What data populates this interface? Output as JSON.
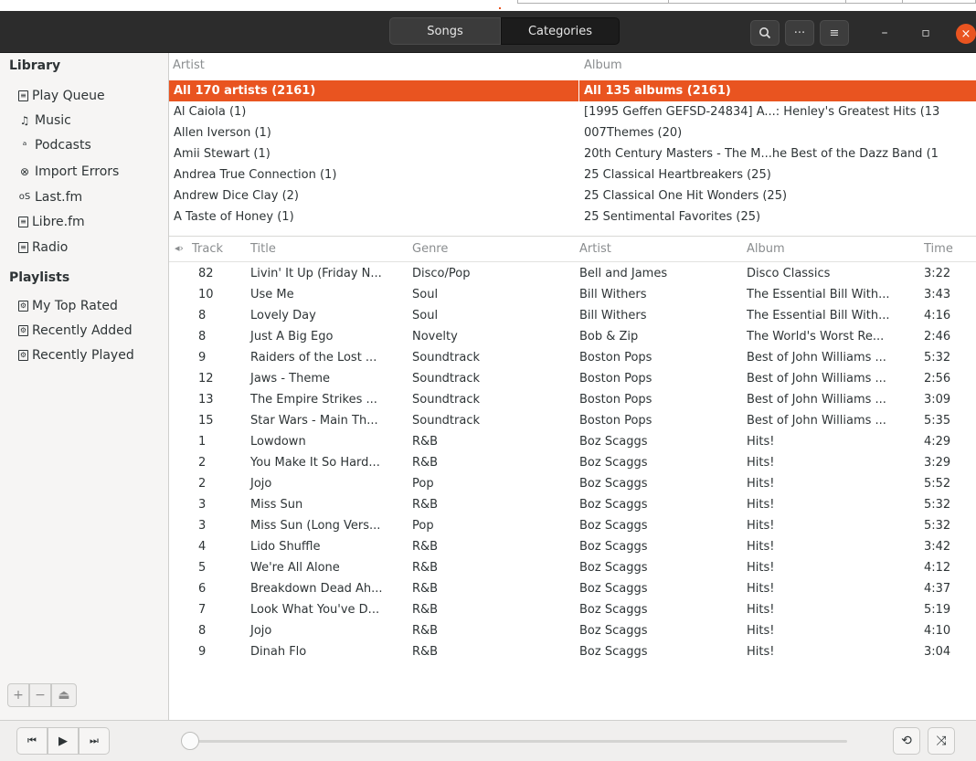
{
  "header": {
    "tabs": [
      {
        "label": "Songs",
        "active": false
      },
      {
        "label": "Categories",
        "active": true
      }
    ],
    "icons": [
      "search-icon",
      "more-icon",
      "menu-icon",
      "minimize-icon",
      "maximize-icon",
      "close-icon"
    ]
  },
  "sidebar": {
    "library_heading": "Library",
    "library_items": [
      {
        "label": "Play Queue",
        "icon": "play-queue-icon"
      },
      {
        "label": "Music",
        "icon": "music-note-icon"
      },
      {
        "label": "Podcasts",
        "icon": "rss-icon"
      },
      {
        "label": "Import Errors",
        "icon": "error-icon"
      },
      {
        "label": "Last.fm",
        "icon": "lastfm-icon"
      },
      {
        "label": "Libre.fm",
        "icon": "librefm-icon"
      },
      {
        "label": "Radio",
        "icon": "radio-icon"
      }
    ],
    "playlists_heading": "Playlists",
    "playlist_items": [
      {
        "label": "My Top Rated",
        "icon": "smart-playlist-icon"
      },
      {
        "label": "Recently Added",
        "icon": "smart-playlist-icon"
      },
      {
        "label": "Recently Played",
        "icon": "smart-playlist-icon"
      }
    ],
    "tools": [
      "+",
      "−",
      "⏏"
    ]
  },
  "browser": {
    "artist_header": "Artist",
    "album_header": "Album",
    "artists": [
      "All 170 artists (2161)",
      "Al Caiola (1)",
      "Allen Iverson (1)",
      "Amii Stewart (1)",
      "Andrea True Connection (1)",
      "Andrew Dice Clay (2)",
      "A Taste of Honey (1)"
    ],
    "albums": [
      "All 135 albums (2161)",
      "[1995 Geffen GEFSD-24834] A...: Henley's Greatest Hits (13",
      "007Themes (20)",
      "20th Century Masters - The M...he Best of the Dazz Band (1",
      "25 Classical Heartbreakers (25)",
      "25 Classical One Hit Wonders (25)",
      "25 Sentimental Favorites (25)"
    ]
  },
  "tracklist": {
    "columns": {
      "track": "Track",
      "title": "Title",
      "genre": "Genre",
      "artist": "Artist",
      "album": "Album",
      "time": "Time"
    },
    "rows": [
      {
        "track": "82",
        "title": "Livin' It Up (Friday N...",
        "genre": "Disco/Pop",
        "artist": "Bell and James",
        "album": "Disco Classics",
        "time": "3:22"
      },
      {
        "track": "10",
        "title": "Use Me",
        "genre": "Soul",
        "artist": "Bill Withers",
        "album": "The Essential Bill With...",
        "time": "3:43"
      },
      {
        "track": "8",
        "title": "Lovely Day",
        "genre": "Soul",
        "artist": "Bill Withers",
        "album": "The Essential Bill With...",
        "time": "4:16"
      },
      {
        "track": "8",
        "title": "Just A Big Ego",
        "genre": "Novelty",
        "artist": "Bob & Zip",
        "album": "The World's Worst Re...",
        "time": "2:46"
      },
      {
        "track": "9",
        "title": "Raiders of the Lost ...",
        "genre": "Soundtrack",
        "artist": "Boston Pops",
        "album": "Best of John Williams ...",
        "time": "5:32"
      },
      {
        "track": "12",
        "title": "Jaws - Theme",
        "genre": "Soundtrack",
        "artist": "Boston Pops",
        "album": "Best of John Williams ...",
        "time": "2:56"
      },
      {
        "track": "13",
        "title": "The Empire Strikes ...",
        "genre": "Soundtrack",
        "artist": "Boston Pops",
        "album": "Best of John Williams ...",
        "time": "3:09"
      },
      {
        "track": "15",
        "title": "Star Wars - Main Th...",
        "genre": "Soundtrack",
        "artist": "Boston Pops",
        "album": "Best of John Williams ...",
        "time": "5:35"
      },
      {
        "track": "1",
        "title": "Lowdown",
        "genre": "R&B",
        "artist": "Boz Scaggs",
        "album": "Hits!",
        "time": "4:29"
      },
      {
        "track": "2",
        "title": "You Make It So Hard...",
        "genre": "R&B",
        "artist": "Boz Scaggs",
        "album": "Hits!",
        "time": "3:29"
      },
      {
        "track": "2",
        "title": "Jojo",
        "genre": "Pop",
        "artist": "Boz Scaggs",
        "album": "Hits!",
        "time": "5:52"
      },
      {
        "track": "3",
        "title": "Miss Sun",
        "genre": "R&B",
        "artist": "Boz Scaggs",
        "album": "Hits!",
        "time": "5:32"
      },
      {
        "track": "3",
        "title": "Miss Sun (Long Vers...",
        "genre": "Pop",
        "artist": "Boz Scaggs",
        "album": "Hits!",
        "time": "5:32"
      },
      {
        "track": "4",
        "title": "Lido Shuffle",
        "genre": "R&B",
        "artist": "Boz Scaggs",
        "album": "Hits!",
        "time": "3:42"
      },
      {
        "track": "5",
        "title": "We're All Alone",
        "genre": "R&B",
        "artist": "Boz Scaggs",
        "album": "Hits!",
        "time": "4:12"
      },
      {
        "track": "6",
        "title": "Breakdown Dead Ah...",
        "genre": "R&B",
        "artist": "Boz Scaggs",
        "album": "Hits!",
        "time": "4:37"
      },
      {
        "track": "7",
        "title": "Look What You've D...",
        "genre": "R&B",
        "artist": "Boz Scaggs",
        "album": "Hits!",
        "time": "5:19"
      },
      {
        "track": "8",
        "title": "Jojo",
        "genre": "R&B",
        "artist": "Boz Scaggs",
        "album": "Hits!",
        "time": "4:10"
      },
      {
        "track": "9",
        "title": "Dinah Flo",
        "genre": "R&B",
        "artist": "Boz Scaggs",
        "album": "Hits!",
        "time": "3:04"
      }
    ]
  },
  "player": {
    "buttons": [
      "previous-icon",
      "play-icon",
      "next-icon"
    ],
    "right_buttons": [
      "repeat-icon",
      "shuffle-icon"
    ]
  },
  "colors": {
    "accent": "#e95420",
    "headerbar": "#2c2c2c",
    "sidebar": "#f6f5f4"
  }
}
